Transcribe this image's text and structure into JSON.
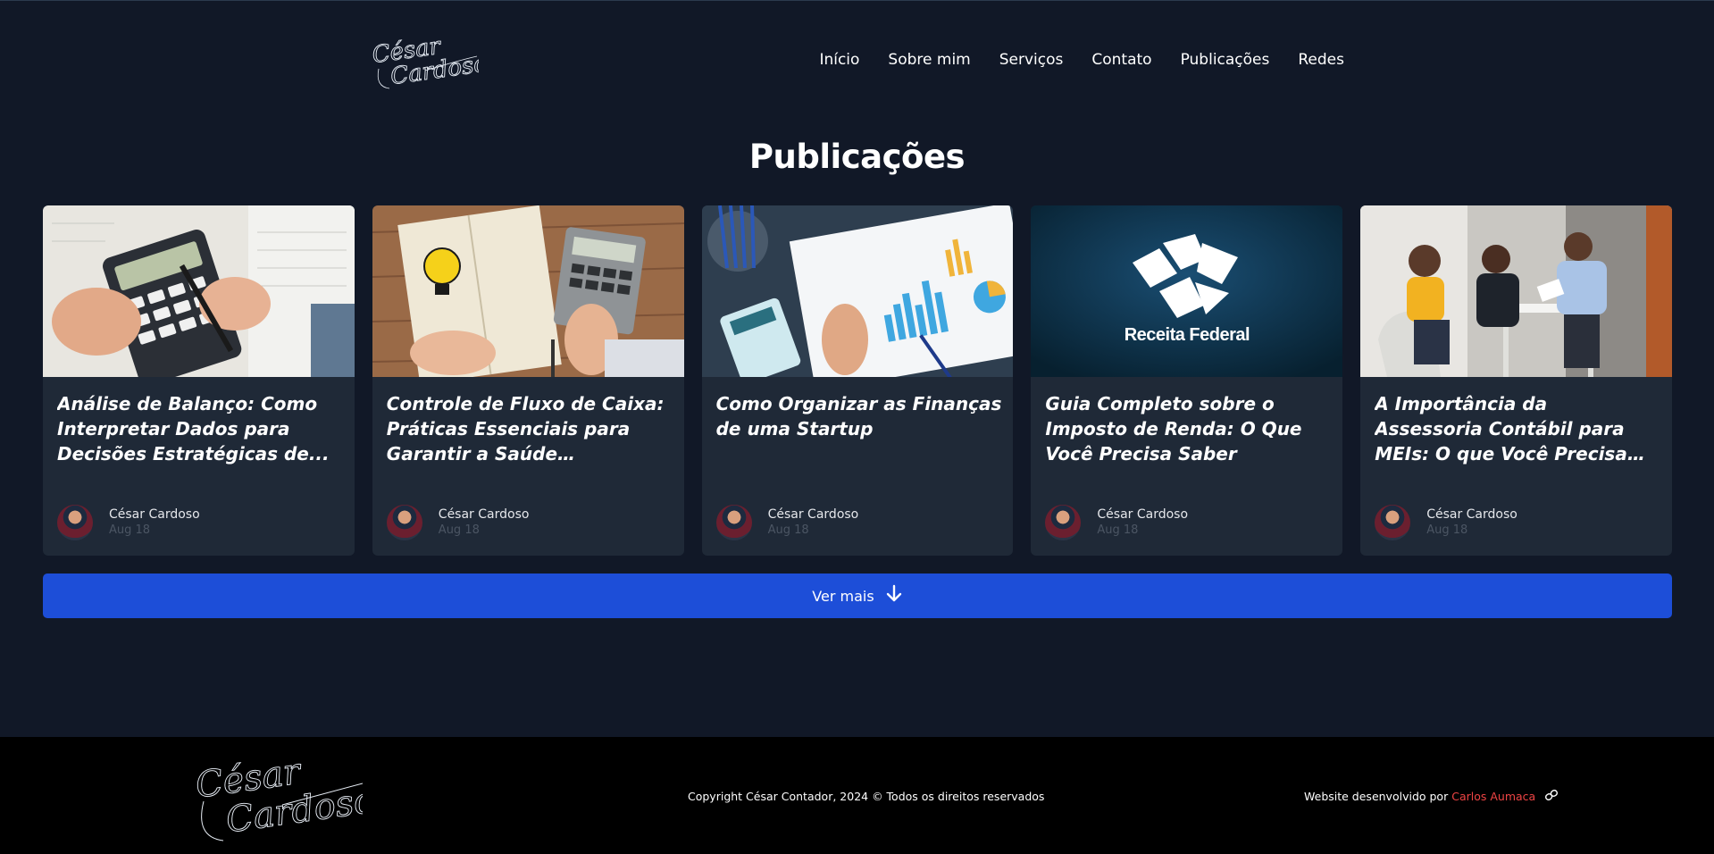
{
  "brand": {
    "logo_line1": "César",
    "logo_line2": "Cardoso"
  },
  "nav": {
    "items": [
      {
        "label": "Início"
      },
      {
        "label": "Sobre mim"
      },
      {
        "label": "Serviços"
      },
      {
        "label": "Contato"
      },
      {
        "label": "Publicações"
      },
      {
        "label": "Redes"
      }
    ]
  },
  "main": {
    "title": "Publicações",
    "posts": [
      {
        "title": "Análise de Balanço: Como Interpretar Dados para Decisões Estratégicas de...",
        "author": "César Cardoso",
        "date": "Aug 18"
      },
      {
        "title": "Controle de Fluxo de Caixa: Práticas Essenciais para Garantir a Saúde Financeira...",
        "author": "César Cardoso",
        "date": "Aug 18"
      },
      {
        "title": "Como Organizar as Finanças de uma Startup",
        "author": "César Cardoso",
        "date": "Aug 18"
      },
      {
        "title": "Guia Completo sobre o Imposto de Renda: O Que Você Precisa Saber",
        "author": "César Cardoso",
        "date": "Aug 18",
        "image_text": "Receita Federal"
      },
      {
        "title": "A Importância da Assessoria Contábil para MEIs: O que Você Precisa Saber para...",
        "author": "César Cardoso",
        "date": "Aug 18"
      }
    ],
    "more_label": "Ver mais",
    "more_icon": "arrow-down-icon"
  },
  "footer": {
    "copyright": "Copyright César Contador, 2024 © Todos os direitos reservados",
    "credit_prefix": "Website desenvolvido por",
    "credit_name": "Carlos Aumaca",
    "credit_icon": "link-icon"
  },
  "colors": {
    "background": "#111827",
    "card": "#1f2937",
    "button": "#1d4ed8",
    "footer": "#000000",
    "credit_link": "#ef4444"
  }
}
